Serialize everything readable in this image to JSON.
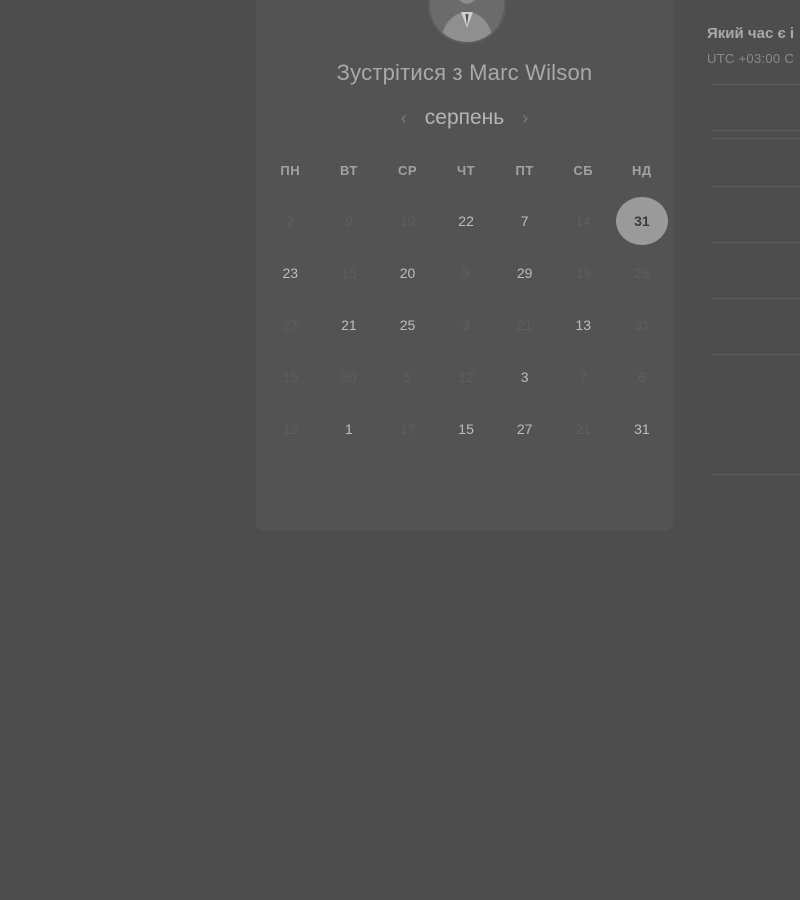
{
  "title": {
    "prefix": "Зустрітися з",
    "host_name": "Marc Wilson"
  },
  "calendar": {
    "month": "серпень",
    "prev_icon": "chevron-left-icon",
    "next_icon": "chevron-right-icon",
    "weekdays": [
      "ПН",
      "ВТ",
      "СР",
      "ЧТ",
      "ПТ",
      "СБ",
      "НД"
    ],
    "days": [
      {
        "label": "2",
        "available": false
      },
      {
        "label": "9",
        "available": false
      },
      {
        "label": "19",
        "available": false
      },
      {
        "label": "22",
        "available": true
      },
      {
        "label": "7",
        "available": true
      },
      {
        "label": "14",
        "available": false
      },
      {
        "label": "31",
        "available": true,
        "selected": true
      },
      {
        "label": "23",
        "available": true
      },
      {
        "label": "15",
        "available": false
      },
      {
        "label": "20",
        "available": true
      },
      {
        "label": "9",
        "available": false
      },
      {
        "label": "29",
        "available": true
      },
      {
        "label": "19",
        "available": false
      },
      {
        "label": "28",
        "available": false
      },
      {
        "label": "27",
        "available": false
      },
      {
        "label": "21",
        "available": true
      },
      {
        "label": "25",
        "available": true
      },
      {
        "label": "3",
        "available": false
      },
      {
        "label": "21",
        "available": false
      },
      {
        "label": "13",
        "available": true
      },
      {
        "label": "31",
        "available": false
      },
      {
        "label": "15",
        "available": false
      },
      {
        "label": "30",
        "available": false
      },
      {
        "label": "5",
        "available": false
      },
      {
        "label": "12",
        "available": false
      },
      {
        "label": "3",
        "available": true
      },
      {
        "label": "7",
        "available": false
      },
      {
        "label": "6",
        "available": false
      },
      {
        "label": "12",
        "available": false
      },
      {
        "label": "1",
        "available": true
      },
      {
        "label": "17",
        "available": false
      },
      {
        "label": "15",
        "available": true
      },
      {
        "label": "27",
        "available": true
      },
      {
        "label": "21",
        "available": false
      },
      {
        "label": "31",
        "available": true
      }
    ]
  },
  "side_panel": {
    "heading": "Який час є і",
    "timezone": "UTC +03:00 С"
  },
  "avatar_icon": "person-avatar-icon"
}
